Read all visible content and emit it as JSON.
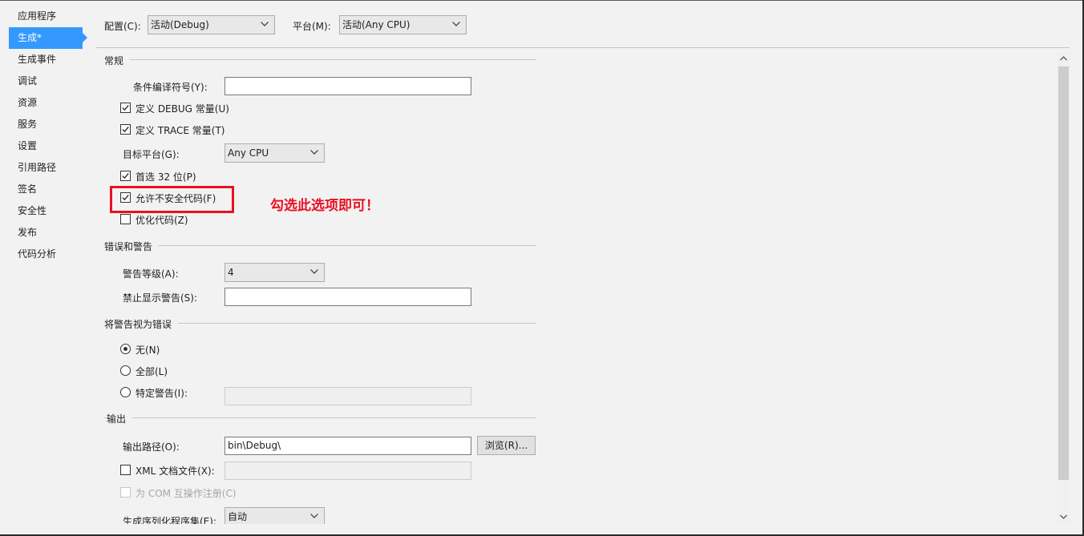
{
  "sidebar": {
    "items": [
      {
        "label": "应用程序"
      },
      {
        "label": "生成*"
      },
      {
        "label": "生成事件"
      },
      {
        "label": "调试"
      },
      {
        "label": "资源"
      },
      {
        "label": "服务"
      },
      {
        "label": "设置"
      },
      {
        "label": "引用路径"
      },
      {
        "label": "签名"
      },
      {
        "label": "安全性"
      },
      {
        "label": "发布"
      },
      {
        "label": "代码分析"
      }
    ],
    "active_index": 1
  },
  "topbar": {
    "config_label": "配置(C):",
    "config_value": "活动(Debug)",
    "platform_label": "平台(M):",
    "platform_value": "活动(Any CPU)"
  },
  "general": {
    "title": "常规",
    "conditional_symbols_label": "条件编译符号(Y):",
    "conditional_symbols_value": "",
    "define_debug_label": "定义 DEBUG 常量(U)",
    "define_debug_checked": true,
    "define_trace_label": "定义 TRACE 常量(T)",
    "define_trace_checked": true,
    "target_platform_label": "目标平台(G):",
    "target_platform_value": "Any CPU",
    "prefer32_label": "首选 32 位(P)",
    "prefer32_checked": true,
    "allow_unsafe_label": "允许不安全代码(F)",
    "allow_unsafe_checked": true,
    "optimize_label": "优化代码(Z)",
    "optimize_checked": false
  },
  "annotation": {
    "text": "勾选此选项即可！",
    "color": "#e81123"
  },
  "errors": {
    "title": "错误和警告",
    "warning_level_label": "警告等级(A):",
    "warning_level_value": "4",
    "suppress_label": "禁止显示警告(S):",
    "suppress_value": ""
  },
  "treat_warnings": {
    "title": "将警告视为错误",
    "none_label": "无(N)",
    "all_label": "全部(L)",
    "specific_label": "特定警告(I):",
    "selected": "none"
  },
  "output": {
    "title": "输出",
    "path_label": "输出路径(O):",
    "path_value": "bin\\Debug\\",
    "browse_label": "浏览(R)...",
    "xml_doc_label": "XML 文档文件(X):",
    "com_label": "为 COM 互操作注册(C)",
    "serialization_label": "生成序列化程序集(E):",
    "serialization_value": "自动"
  },
  "colors": {
    "accent": "#3399ff",
    "highlight": "#e81123"
  }
}
